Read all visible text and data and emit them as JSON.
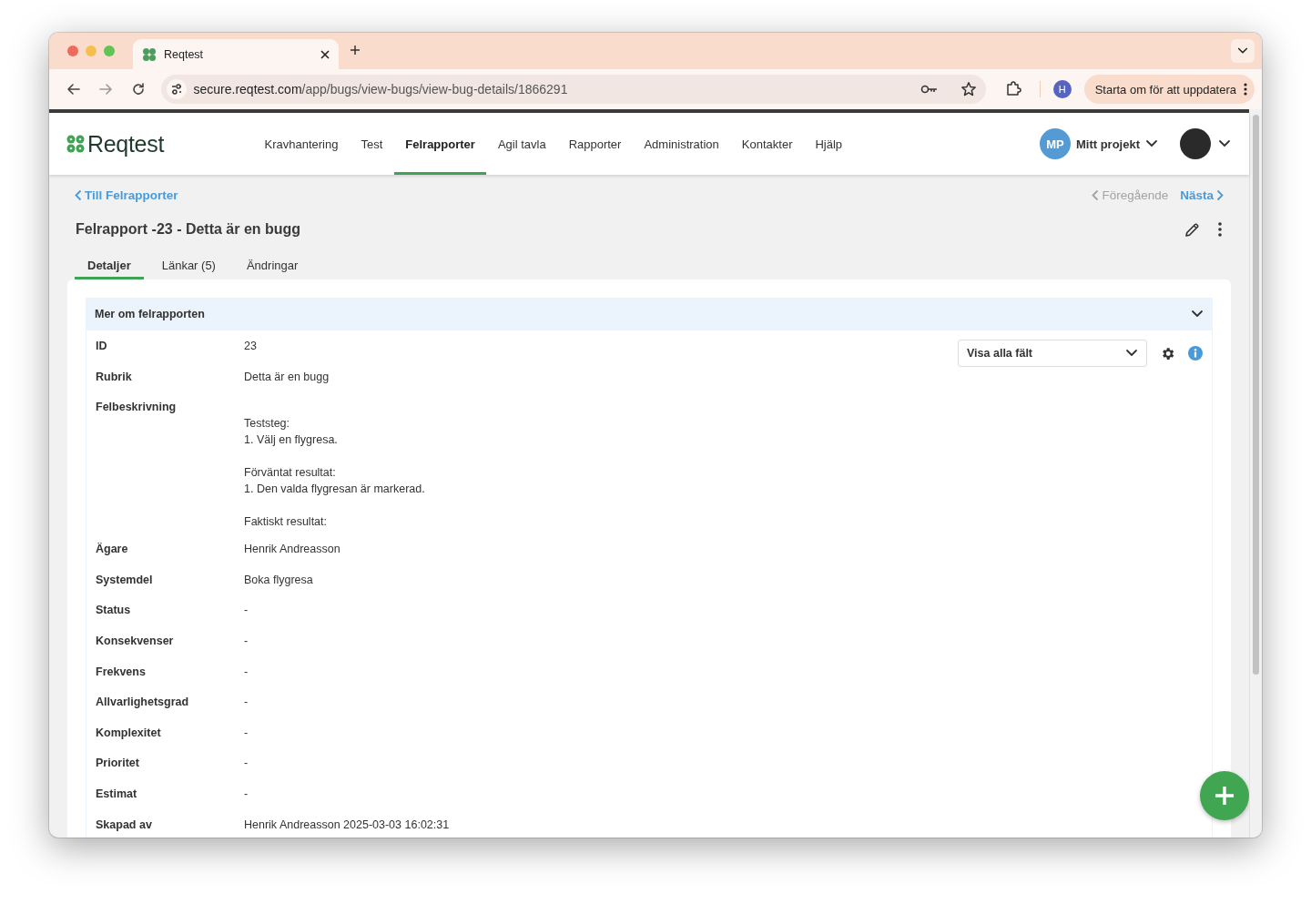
{
  "browser": {
    "tab_title": "Reqtest",
    "url_host": "secure.reqtest.com",
    "url_path": "/app/bugs/view-bugs/view-bug-details/1866291",
    "profile_initial": "H",
    "update_button": "Starta om för att uppdatera"
  },
  "app": {
    "logo": "Reqtest",
    "nav": [
      {
        "label": "Kravhantering",
        "selected": false
      },
      {
        "label": "Test",
        "selected": false
      },
      {
        "label": "Felrapporter",
        "selected": true
      },
      {
        "label": "Agil tavla",
        "selected": false
      },
      {
        "label": "Rapporter",
        "selected": false
      },
      {
        "label": "Administration",
        "selected": false
      },
      {
        "label": "Kontakter",
        "selected": false
      },
      {
        "label": "Hjälp",
        "selected": false
      }
    ],
    "project_initials": "MP",
    "project_name": "Mitt projekt"
  },
  "page": {
    "back_link": "Till Felrapporter",
    "pager": [
      {
        "label": "Föregående",
        "kind": "prev",
        "disabled": true
      },
      {
        "label": "Nästa",
        "kind": "next",
        "disabled": false
      }
    ],
    "title": "Felrapport -23 - Detta är en bugg",
    "tabs": [
      {
        "label": "Detaljer",
        "selected": true
      },
      {
        "label": "Länkar (5)",
        "selected": false
      },
      {
        "label": "Ändringar",
        "selected": false
      }
    ],
    "section": {
      "title": "Mer om felrapporten",
      "expanded": true,
      "view_select": "Visa alla fält",
      "fields": [
        {
          "label": "ID",
          "kind": "text",
          "value": "23"
        },
        {
          "label": "Rubrik",
          "kind": "text",
          "value": "Detta är en bugg"
        },
        {
          "label": "Felbeskrivning",
          "kind": "multiline",
          "value": "Teststeg:\n1. Välj en flygresa.\n\nFörväntat resultat:\n1. Den valda flygresan är markerad.\n\nFaktiskt resultat:"
        },
        {
          "label": "Ägare",
          "kind": "text",
          "value": "Henrik Andreasson"
        },
        {
          "label": "Systemdel",
          "kind": "text",
          "value": "Boka flygresa"
        },
        {
          "label": "Status",
          "kind": "text",
          "value": "-"
        },
        {
          "label": "Konsekvenser",
          "kind": "text",
          "value": "-"
        },
        {
          "label": "Frekvens",
          "kind": "text",
          "value": "-"
        },
        {
          "label": "Allvarlighetsgrad",
          "kind": "text",
          "value": "-"
        },
        {
          "label": "Komplexitet",
          "kind": "text",
          "value": "-"
        },
        {
          "label": "Prioritet",
          "kind": "text",
          "value": "-"
        },
        {
          "label": "Estimat",
          "kind": "text",
          "value": "-"
        },
        {
          "label": "Skapad av",
          "kind": "text",
          "value": "Henrik Andreasson 2025-03-03 16:02:31"
        }
      ]
    }
  }
}
